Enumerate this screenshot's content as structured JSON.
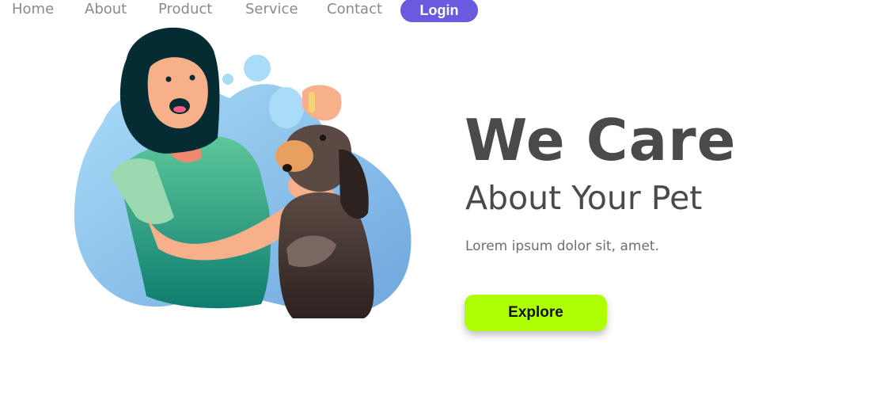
{
  "nav": {
    "items": [
      {
        "label": "Home"
      },
      {
        "label": "About"
      },
      {
        "label": "Product"
      },
      {
        "label": "Service"
      },
      {
        "label": "Contact"
      }
    ],
    "login_label": "Login"
  },
  "hero": {
    "title": "We Care",
    "subtitle": "About Your Pet",
    "tagline": "Lorem ipsum dolor sit, amet.",
    "cta_label": "Explore"
  },
  "colors": {
    "login_button": "#6a5ae0",
    "cta_button": "#adff02",
    "heading_text": "#4a4a4a",
    "nav_text": "#8a8a8a",
    "blob_blue": "#8fc9ec"
  }
}
